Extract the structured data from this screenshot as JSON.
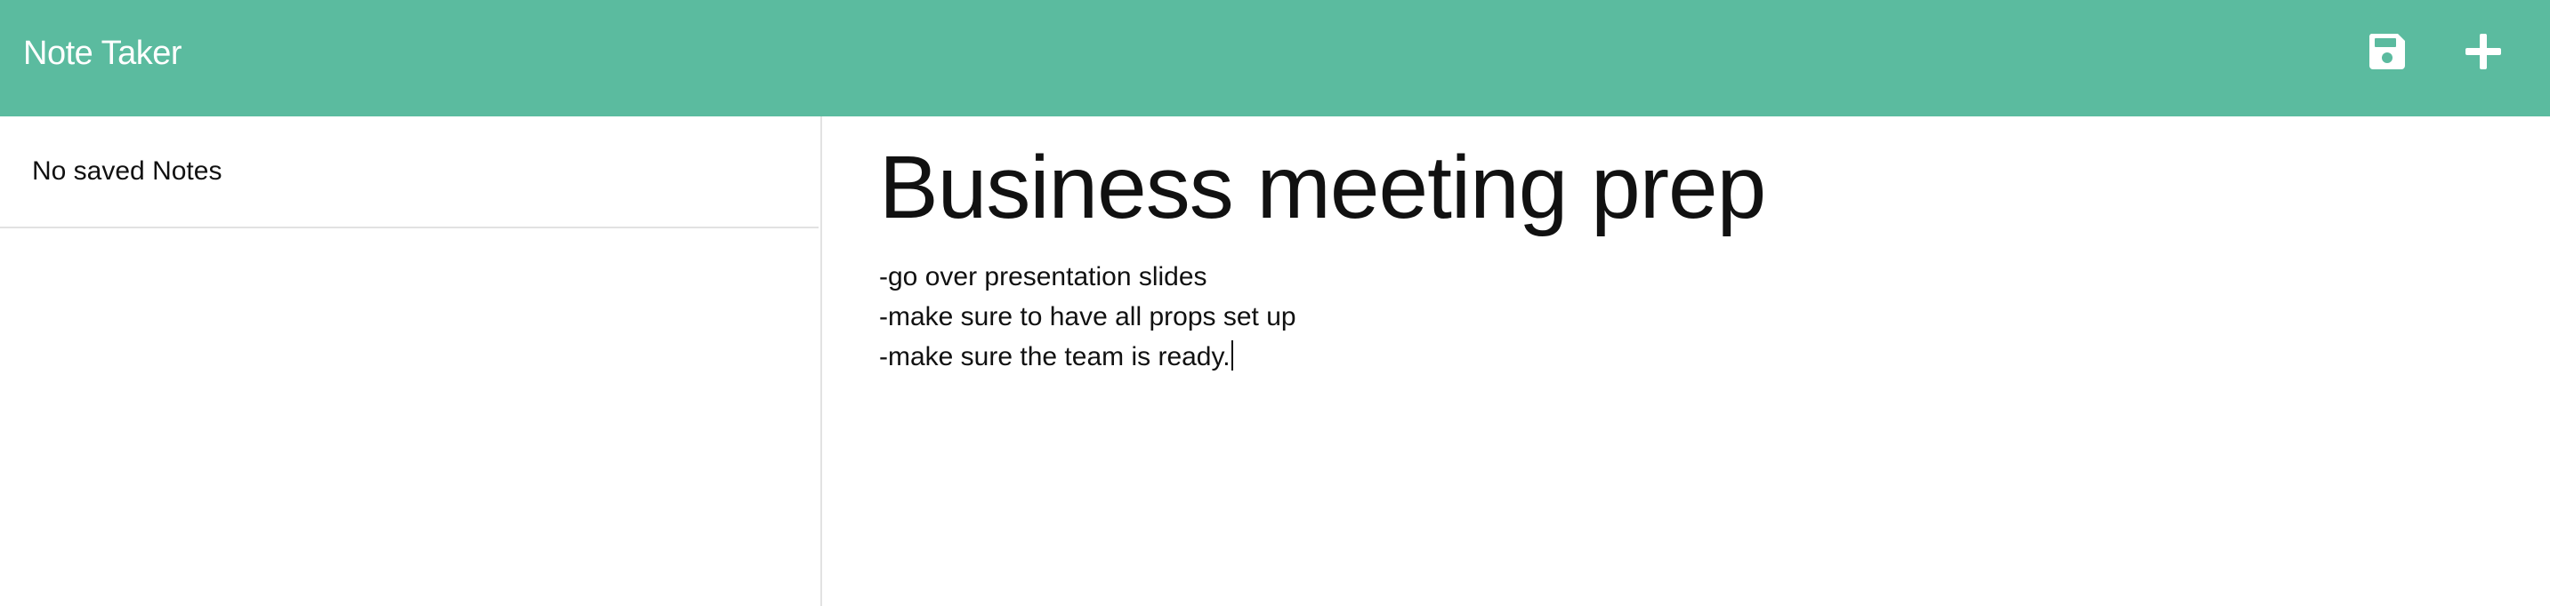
{
  "navbar": {
    "title": "Note Taker",
    "background_color": "#5bbb9f",
    "save_icon": "save-icon",
    "new_note_icon": "plus-icon"
  },
  "sidebar": {
    "empty_message": "No saved Notes"
  },
  "editor": {
    "title": "Business meeting prep",
    "lines": [
      "-go over presentation slides",
      "-make sure to have all props set up",
      "-make sure the team is ready."
    ]
  }
}
